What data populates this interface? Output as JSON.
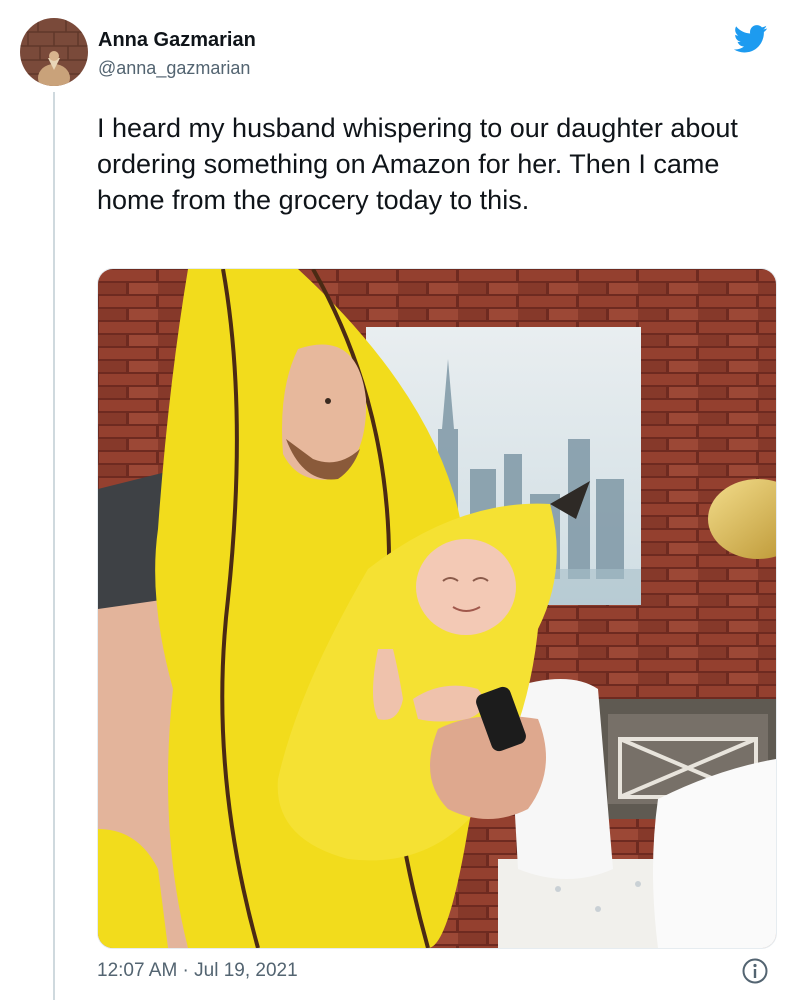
{
  "author": {
    "display_name": "Anna Gazmarian",
    "handle": "@anna_gazmarian"
  },
  "tweet": {
    "text": "I heard my husband whispering to our daughter about ordering something on Amazon for her. Then I came home from the grocery today to this.",
    "timestamp": "12:07 AM · Jul 19, 2021"
  },
  "icons": {
    "platform": "twitter-bird-icon",
    "info": "info-icon"
  },
  "colors": {
    "brand_blue": "#1d9bf0",
    "secondary_text": "#536471",
    "banana_yellow": "#f2dc1c",
    "brick": "#8e3b2c"
  }
}
